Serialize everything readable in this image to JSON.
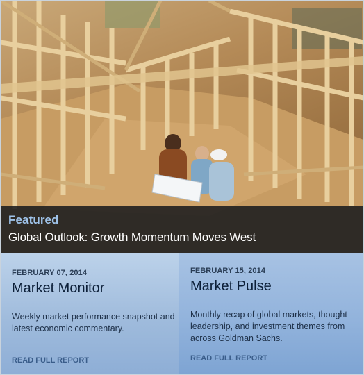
{
  "featured": {
    "tag": "Featured",
    "title": "Global Outlook: Growth Momentum Moves West"
  },
  "cards": [
    {
      "date": "FEBRUARY 07, 2014",
      "title": "Market Monitor",
      "description": "Weekly market performance snapshot and latest economic commentary.",
      "link_label": "READ FULL REPORT"
    },
    {
      "date": "FEBRUARY 15, 2014",
      "title": "Market Pulse",
      "description": "Monthly recap of global markets, thought leadership, and investment themes from across Goldman Sachs.",
      "link_label": "READ FULL REPORT"
    }
  ],
  "colors": {
    "featured_tag": "#9fc3ea",
    "caption_bg": "#16181c",
    "card_bg": "#a7c2e3",
    "link": "#3a5d8a"
  }
}
